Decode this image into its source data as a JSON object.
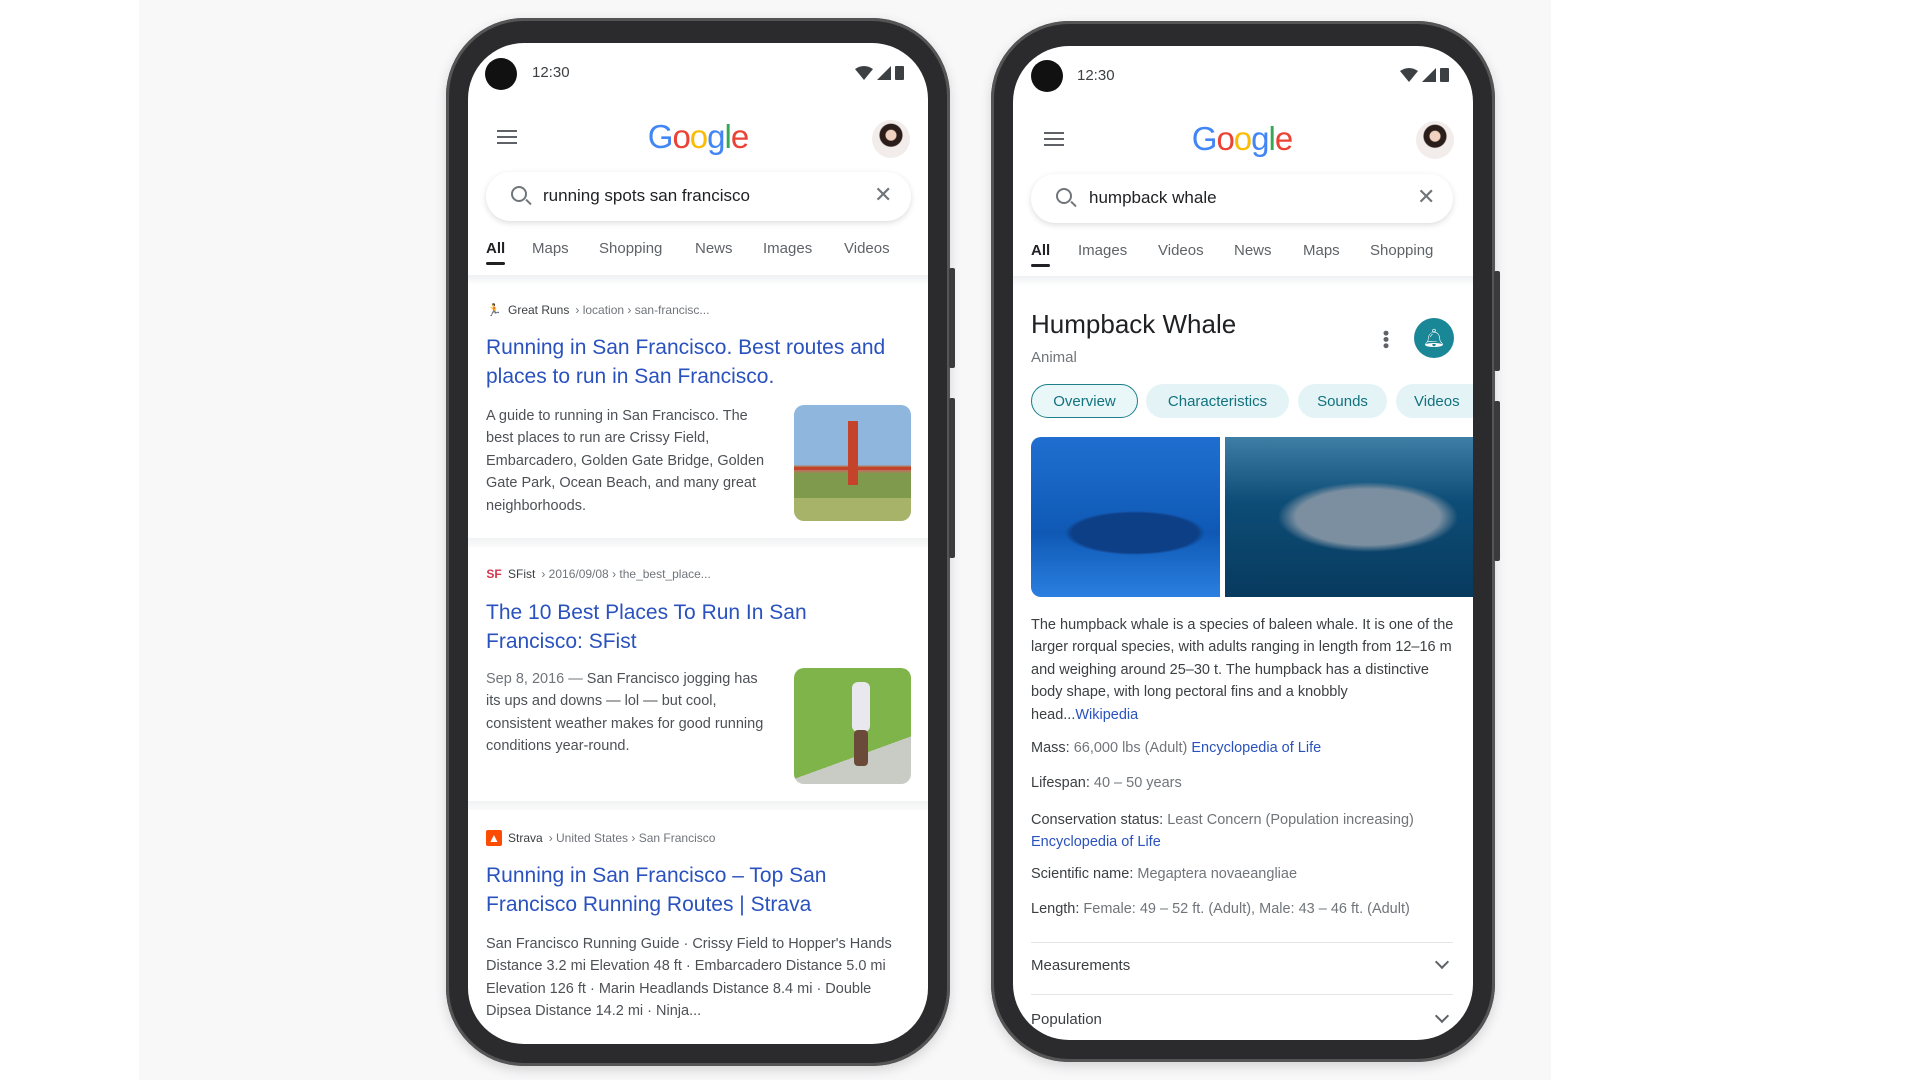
{
  "left_phone": {
    "status": {
      "time": "12:30"
    },
    "logo": "Google",
    "search": {
      "query": "running spots san francisco"
    },
    "tabs": [
      {
        "label": "All"
      },
      {
        "label": "Maps"
      },
      {
        "label": "Shopping"
      },
      {
        "label": "News"
      },
      {
        "label": "Images"
      },
      {
        "label": "Videos"
      }
    ],
    "results": [
      {
        "site": "Great Runs",
        "path": "› location › san-francisc...",
        "title": "Running in San Francisco. Best routes and places to run in San Francisco.",
        "snippet": "A guide to running in San Francisco. The best places to run are Crissy Field, Embarcadero, Golden Gate Bridge, Golden Gate Park, Ocean Beach, and many great neighborhoods.",
        "favicon": "runner-icon"
      },
      {
        "site": "SFist",
        "path": "› 2016/09/08 › the_best_place...",
        "title": "The 10 Best Places To Run In San Francisco: SFist",
        "date": "Sep 8, 2016 —",
        "snippet": "San Francisco jogging has its ups and downs — lol — but cool, consistent weather makes for good running conditions year-round.",
        "favicon": "SF"
      },
      {
        "site": "Strava",
        "path": "› United States › San Francisco",
        "title": "Running in San Francisco – Top San Francisco Running Routes | Strava",
        "snippet": "San Francisco Running Guide · Crissy Field to Hopper's Hands Distance 3.2 mi Elevation 48 ft · Embarcadero Distance 5.0 mi Elevation 126 ft · Marin Headlands Distance 8.4 mi · Double Dipsea Distance 14.2 mi · Ninja...",
        "favicon": "strava-icon"
      }
    ]
  },
  "right_phone": {
    "status": {
      "time": "12:30"
    },
    "logo": "Google",
    "search": {
      "query": "humpback whale"
    },
    "tabs": [
      {
        "label": "All"
      },
      {
        "label": "Images"
      },
      {
        "label": "Videos"
      },
      {
        "label": "News"
      },
      {
        "label": "Maps"
      },
      {
        "label": "Shopping"
      }
    ],
    "panel": {
      "title": "Humpback Whale",
      "subtitle": "Animal",
      "chips": [
        {
          "label": "Overview"
        },
        {
          "label": "Characteristics"
        },
        {
          "label": "Sounds"
        },
        {
          "label": "Videos"
        }
      ],
      "description": "The humpback whale is a species of baleen whale. It is one of the larger rorqual species, with adults ranging in length from 12–16 m and weighing around 25–30 t. The humpback has a distinctive body shape, with long pectoral fins and a knobbly head...",
      "description_source": "Wikipedia",
      "facts": [
        {
          "label": "Mass:",
          "value": "66,000 lbs (Adult)",
          "source": "Encyclopedia of Life"
        },
        {
          "label": "Lifespan:",
          "value": "40 – 50 years"
        },
        {
          "label": "Conservation status:",
          "value": "Least Concern (Population increasing)",
          "source": "Encyclopedia of Life"
        },
        {
          "label": "Scientific name:",
          "value": "Megaptera novaeangliae"
        },
        {
          "label": "Length:",
          "value": "Female: 49 – 52 ft. (Adult), Male: 43 – 46 ft. (Adult)"
        }
      ],
      "sections": [
        {
          "label": "Measurements"
        },
        {
          "label": "Population"
        }
      ]
    }
  },
  "colors": {
    "link": "#2a52be",
    "teal": "#1a8796",
    "chip_bg": "#e4f4f6"
  }
}
